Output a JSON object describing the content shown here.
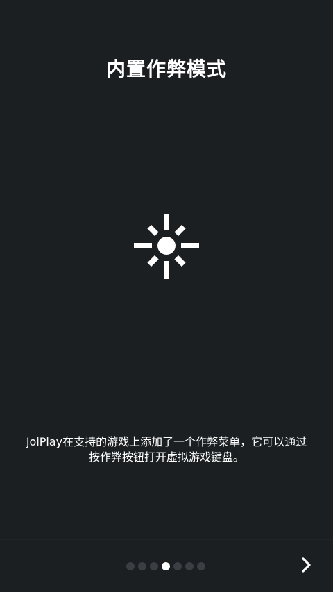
{
  "title": "内置作弊模式",
  "hero_icon": "brightness-sun-icon",
  "description_line1": "JoiPlay在支持的游戏上添加了一个作弊菜单，它可以通过",
  "description_line2": "按作弊按钮打开虚拟游戏键盘。",
  "pager": {
    "total": 7,
    "current": 4
  },
  "next_icon": "chevron-right-icon",
  "colors": {
    "background": "#1b1f22",
    "text": "#ffffff",
    "dot_inactive": "#3a3f44",
    "dot_active": "#ffffff"
  }
}
